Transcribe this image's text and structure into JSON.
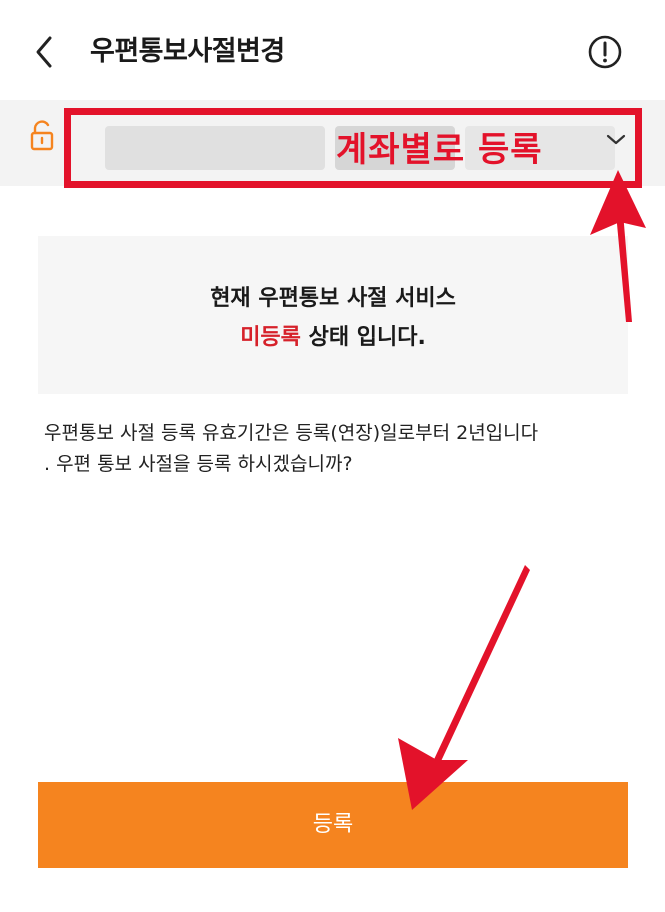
{
  "header": {
    "title": "우편통보사절변경"
  },
  "account": {
    "label": "계좌별로 등록"
  },
  "status": {
    "line1": "현재 우편통보 사절 서비스",
    "highlight": "미등록",
    "line2_rest": " 상태 입니다."
  },
  "description": {
    "line1": "우편통보 사절 등록 유효기간은 등록(연장)일로부터 2년입니다",
    "line2": ". 우편 통보 사절을 등록 하시겠습니까?"
  },
  "actions": {
    "register_label": "등록"
  },
  "colors": {
    "accent": "#f5841f",
    "highlight_red": "#e3122a",
    "status_red": "#d6212a"
  }
}
